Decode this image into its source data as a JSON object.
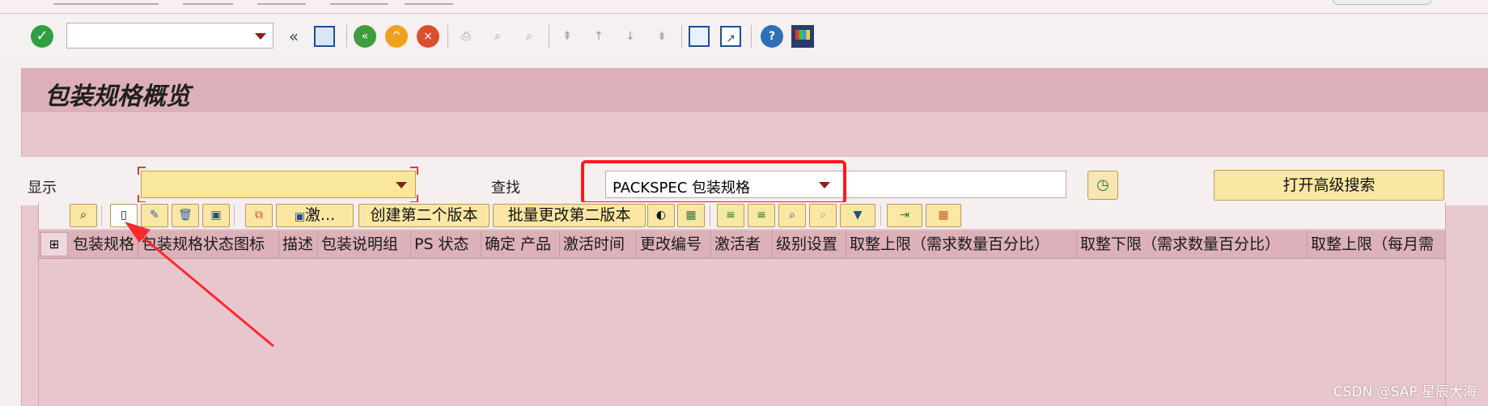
{
  "system_toolbar": {
    "command_field_value": "",
    "icons": [
      "enter-icon",
      "back-arrows-icon",
      "save-icon",
      "back-icon",
      "exit-icon",
      "cancel-icon",
      "print-icon",
      "find-icon",
      "find-next-icon",
      "first-page-icon",
      "previous-page-icon",
      "next-page-icon",
      "last-page-icon",
      "new-session-icon",
      "shortcut-icon",
      "help-icon",
      "customize-layout-icon"
    ]
  },
  "page": {
    "title": "包装规格概览"
  },
  "selection": {
    "display_label": "显示",
    "display_value": "",
    "find_label": "查找",
    "find_value": "PACKSPEC 包装规格",
    "advanced_search_label": "打开高级搜索"
  },
  "grid_toolbar": {
    "activate_label": "激...",
    "create_second_version_label": "创建第二个版本",
    "mass_change_second_version_label": "批量更改第二版本"
  },
  "table": {
    "columns": [
      "包装规格",
      "包装规格状态图标",
      "描述",
      "包装说明组",
      "PS 状态",
      "确定 产品",
      "激活时间",
      "更改编号",
      "激活者",
      "级别设置",
      "取整上限（需求数量百分比）",
      "取整下限（需求数量百分比）",
      "取整上限（每月需"
    ]
  },
  "watermark": "CSDN @SAP 星辰大海",
  "colors": {
    "accent_red": "#ff1a1a",
    "title_bg": "#ddafb8",
    "button_yellow": "#fbe7a4"
  }
}
